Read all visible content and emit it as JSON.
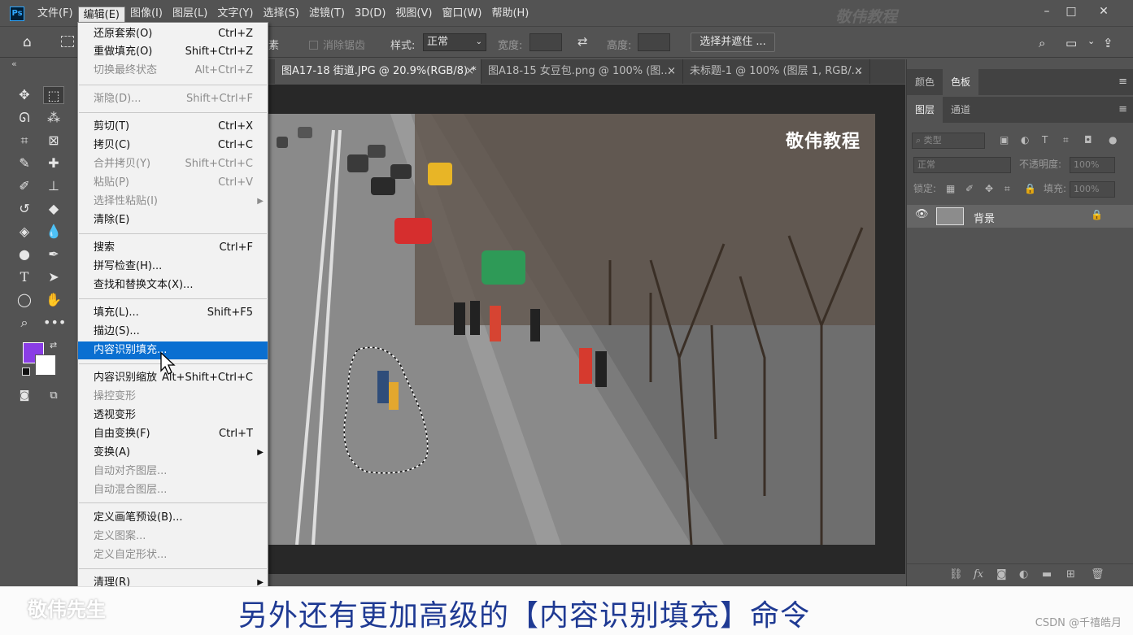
{
  "app": {
    "logo": "Ps"
  },
  "menubar": {
    "items": [
      "文件(F)",
      "编辑(E)",
      "图像(I)",
      "图层(L)",
      "文字(Y)",
      "选择(S)",
      "滤镜(T)",
      "3D(D)",
      "视图(V)",
      "窗口(W)",
      "帮助(H)"
    ],
    "active": "编辑(E)",
    "watermark": "敬伟教程",
    "window_controls": [
      "–",
      "□",
      "✕"
    ]
  },
  "options": {
    "feather_suffix": "素",
    "antialias": "消除锯齿",
    "style_label": "样式:",
    "style_value": "正常",
    "width_label": "宽度:",
    "height_label": "高度:",
    "select_mask_button": "选择并遮住 ..."
  },
  "tabs": [
    {
      "label": "图A17-18 街道.JPG @ 20.9%(RGB/8) *",
      "close": "×",
      "active": true
    },
    {
      "label": "图A18-15 女豆包.png @ 100% (图...",
      "close": "×",
      "active": false
    },
    {
      "label": "未标题-1 @ 100% (图层 1, RGB/...",
      "close": "×",
      "active": false
    }
  ],
  "canvas": {
    "watermark": "敬伟教程"
  },
  "panels": {
    "top_tabs": [
      "颜色",
      "色板"
    ],
    "layer_tabs": [
      "图层",
      "通道"
    ],
    "filter_placeholder": "类型",
    "blend_mode": "正常",
    "opacity_label": "不透明度:",
    "opacity_value": "100%",
    "lock_label": "锁定:",
    "fill_label": "填充:",
    "fill_value": "100%",
    "layer_name": "背景"
  },
  "edit_menu": [
    {
      "label": "还原套索(O)",
      "shortcut": "Ctrl+Z",
      "disabled": false
    },
    {
      "label": "重做填充(O)",
      "shortcut": "Shift+Ctrl+Z",
      "disabled": false
    },
    {
      "label": "切换最终状态",
      "shortcut": "Alt+Ctrl+Z",
      "disabled": true
    },
    {
      "label": "渐隐(D)...",
      "shortcut": "Shift+Ctrl+F",
      "disabled": true
    },
    {
      "label": "剪切(T)",
      "shortcut": "Ctrl+X",
      "disabled": false
    },
    {
      "label": "拷贝(C)",
      "shortcut": "Ctrl+C",
      "disabled": false
    },
    {
      "label": "合并拷贝(Y)",
      "shortcut": "Shift+Ctrl+C",
      "disabled": true
    },
    {
      "label": "粘贴(P)",
      "shortcut": "Ctrl+V",
      "disabled": true
    },
    {
      "label": "选择性粘贴(I)",
      "shortcut": "",
      "disabled": true,
      "submenu": true
    },
    {
      "label": "清除(E)",
      "shortcut": "",
      "disabled": false
    },
    {
      "label": "搜索",
      "shortcut": "Ctrl+F",
      "disabled": false
    },
    {
      "label": "拼写检查(H)...",
      "shortcut": "",
      "disabled": false
    },
    {
      "label": "查找和替换文本(X)...",
      "shortcut": "",
      "disabled": false
    },
    {
      "label": "填充(L)...",
      "shortcut": "Shift+F5",
      "disabled": false
    },
    {
      "label": "描边(S)...",
      "shortcut": "",
      "disabled": false
    },
    {
      "label": "内容识别填充...",
      "shortcut": "",
      "disabled": false,
      "highlighted": true
    },
    {
      "label": "内容识别缩放",
      "shortcut": "Alt+Shift+Ctrl+C",
      "disabled": false
    },
    {
      "label": "操控变形",
      "shortcut": "",
      "disabled": true
    },
    {
      "label": "透视变形",
      "shortcut": "",
      "disabled": false
    },
    {
      "label": "自由变换(F)",
      "shortcut": "Ctrl+T",
      "disabled": false
    },
    {
      "label": "变换(A)",
      "shortcut": "",
      "disabled": false,
      "submenu": true
    },
    {
      "label": "自动对齐图层...",
      "shortcut": "",
      "disabled": true
    },
    {
      "label": "自动混合图层...",
      "shortcut": "",
      "disabled": true
    },
    {
      "label": "定义画笔预设(B)...",
      "shortcut": "",
      "disabled": false
    },
    {
      "label": "定义图案...",
      "shortcut": "",
      "disabled": true
    },
    {
      "label": "定义自定形状...",
      "shortcut": "",
      "disabled": true
    },
    {
      "label": "清理(R)",
      "shortcut": "",
      "disabled": false,
      "submenu": true
    }
  ],
  "colors": {
    "foreground": "#8a3de6",
    "background": "#ffffff",
    "highlight": "#0a6fd1"
  },
  "subtitle": {
    "text": "另外还有更加高级的【内容识别填充】命令",
    "watermark": "敬伟先生",
    "credit": "CSDN @千禧皓月"
  }
}
